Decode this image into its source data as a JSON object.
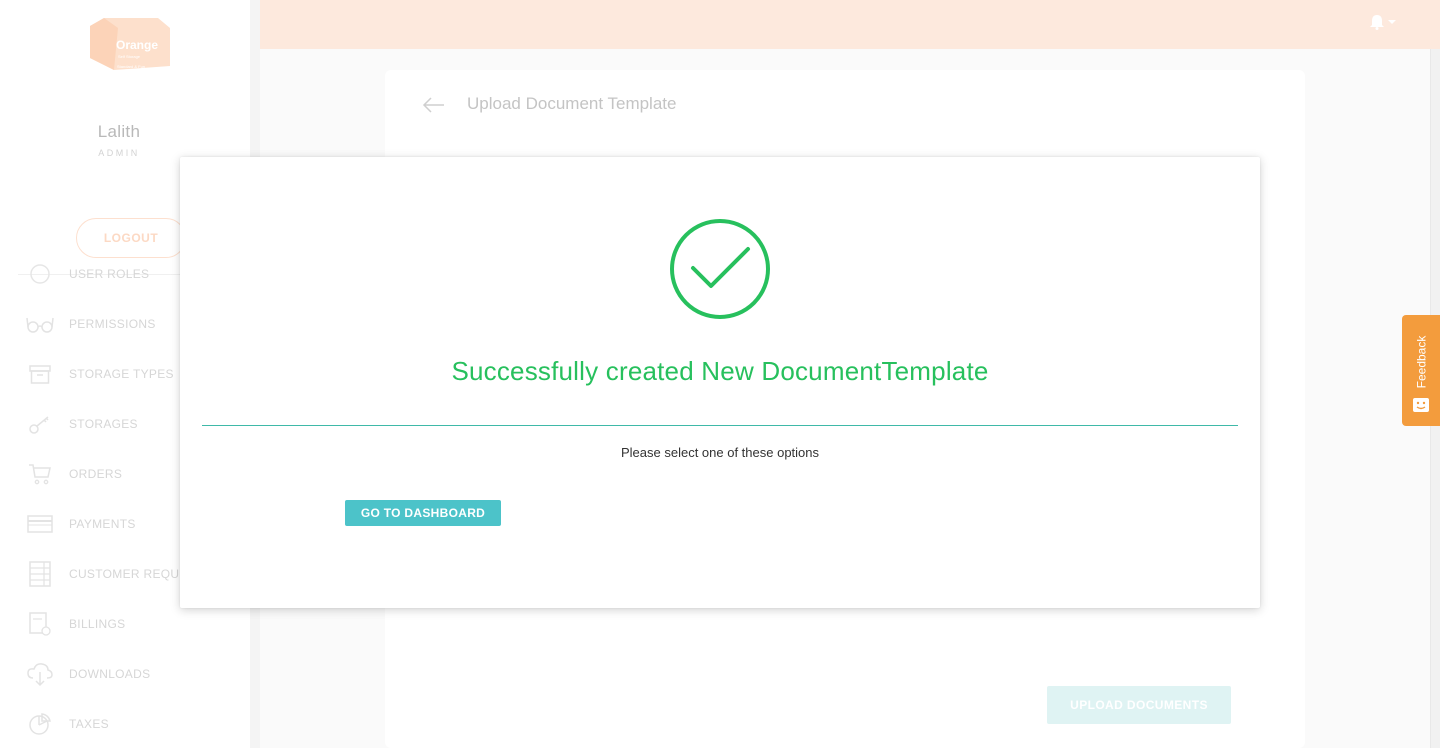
{
  "brand": {
    "logo_text": "Orange",
    "logo_subtext": "Self Storage",
    "logo_tagline": "Standard & Fun"
  },
  "user": {
    "name": "Lalith",
    "role": "ADMIN",
    "logout_label": "LOGOUT"
  },
  "sidebar": {
    "items": [
      {
        "label": "USER ROLES",
        "icon": "user-roles-icon"
      },
      {
        "label": "PERMISSIONS",
        "icon": "glasses-icon"
      },
      {
        "label": "STORAGE TYPES",
        "icon": "archive-box-icon"
      },
      {
        "label": "STORAGES",
        "icon": "key-icon"
      },
      {
        "label": "ORDERS",
        "icon": "cart-icon"
      },
      {
        "label": "PAYMENTS",
        "icon": "credit-card-icon"
      },
      {
        "label": "CUSTOMER REQUESTS",
        "icon": "list-icon"
      },
      {
        "label": "BILLINGS",
        "icon": "billing-icon"
      },
      {
        "label": "DOWNLOADS",
        "icon": "cloud-download-icon"
      },
      {
        "label": "TAXES",
        "icon": "pie-chart-icon"
      }
    ]
  },
  "main": {
    "page_title": "Upload Document Template",
    "upload_button_label": "UPLOAD DOCUMENTS"
  },
  "feedback": {
    "label": "Feedback"
  },
  "modal": {
    "success_message": "Successfully created New DocumentTemplate",
    "subtext": "Please select one of these options",
    "dashboard_button_label": "GO TO DASHBOARD"
  },
  "colors": {
    "success_green": "#27c05d",
    "teal_button": "#4cc3c9",
    "topbar_peach": "#fde9dd",
    "feedback_orange": "#f39c3d"
  }
}
